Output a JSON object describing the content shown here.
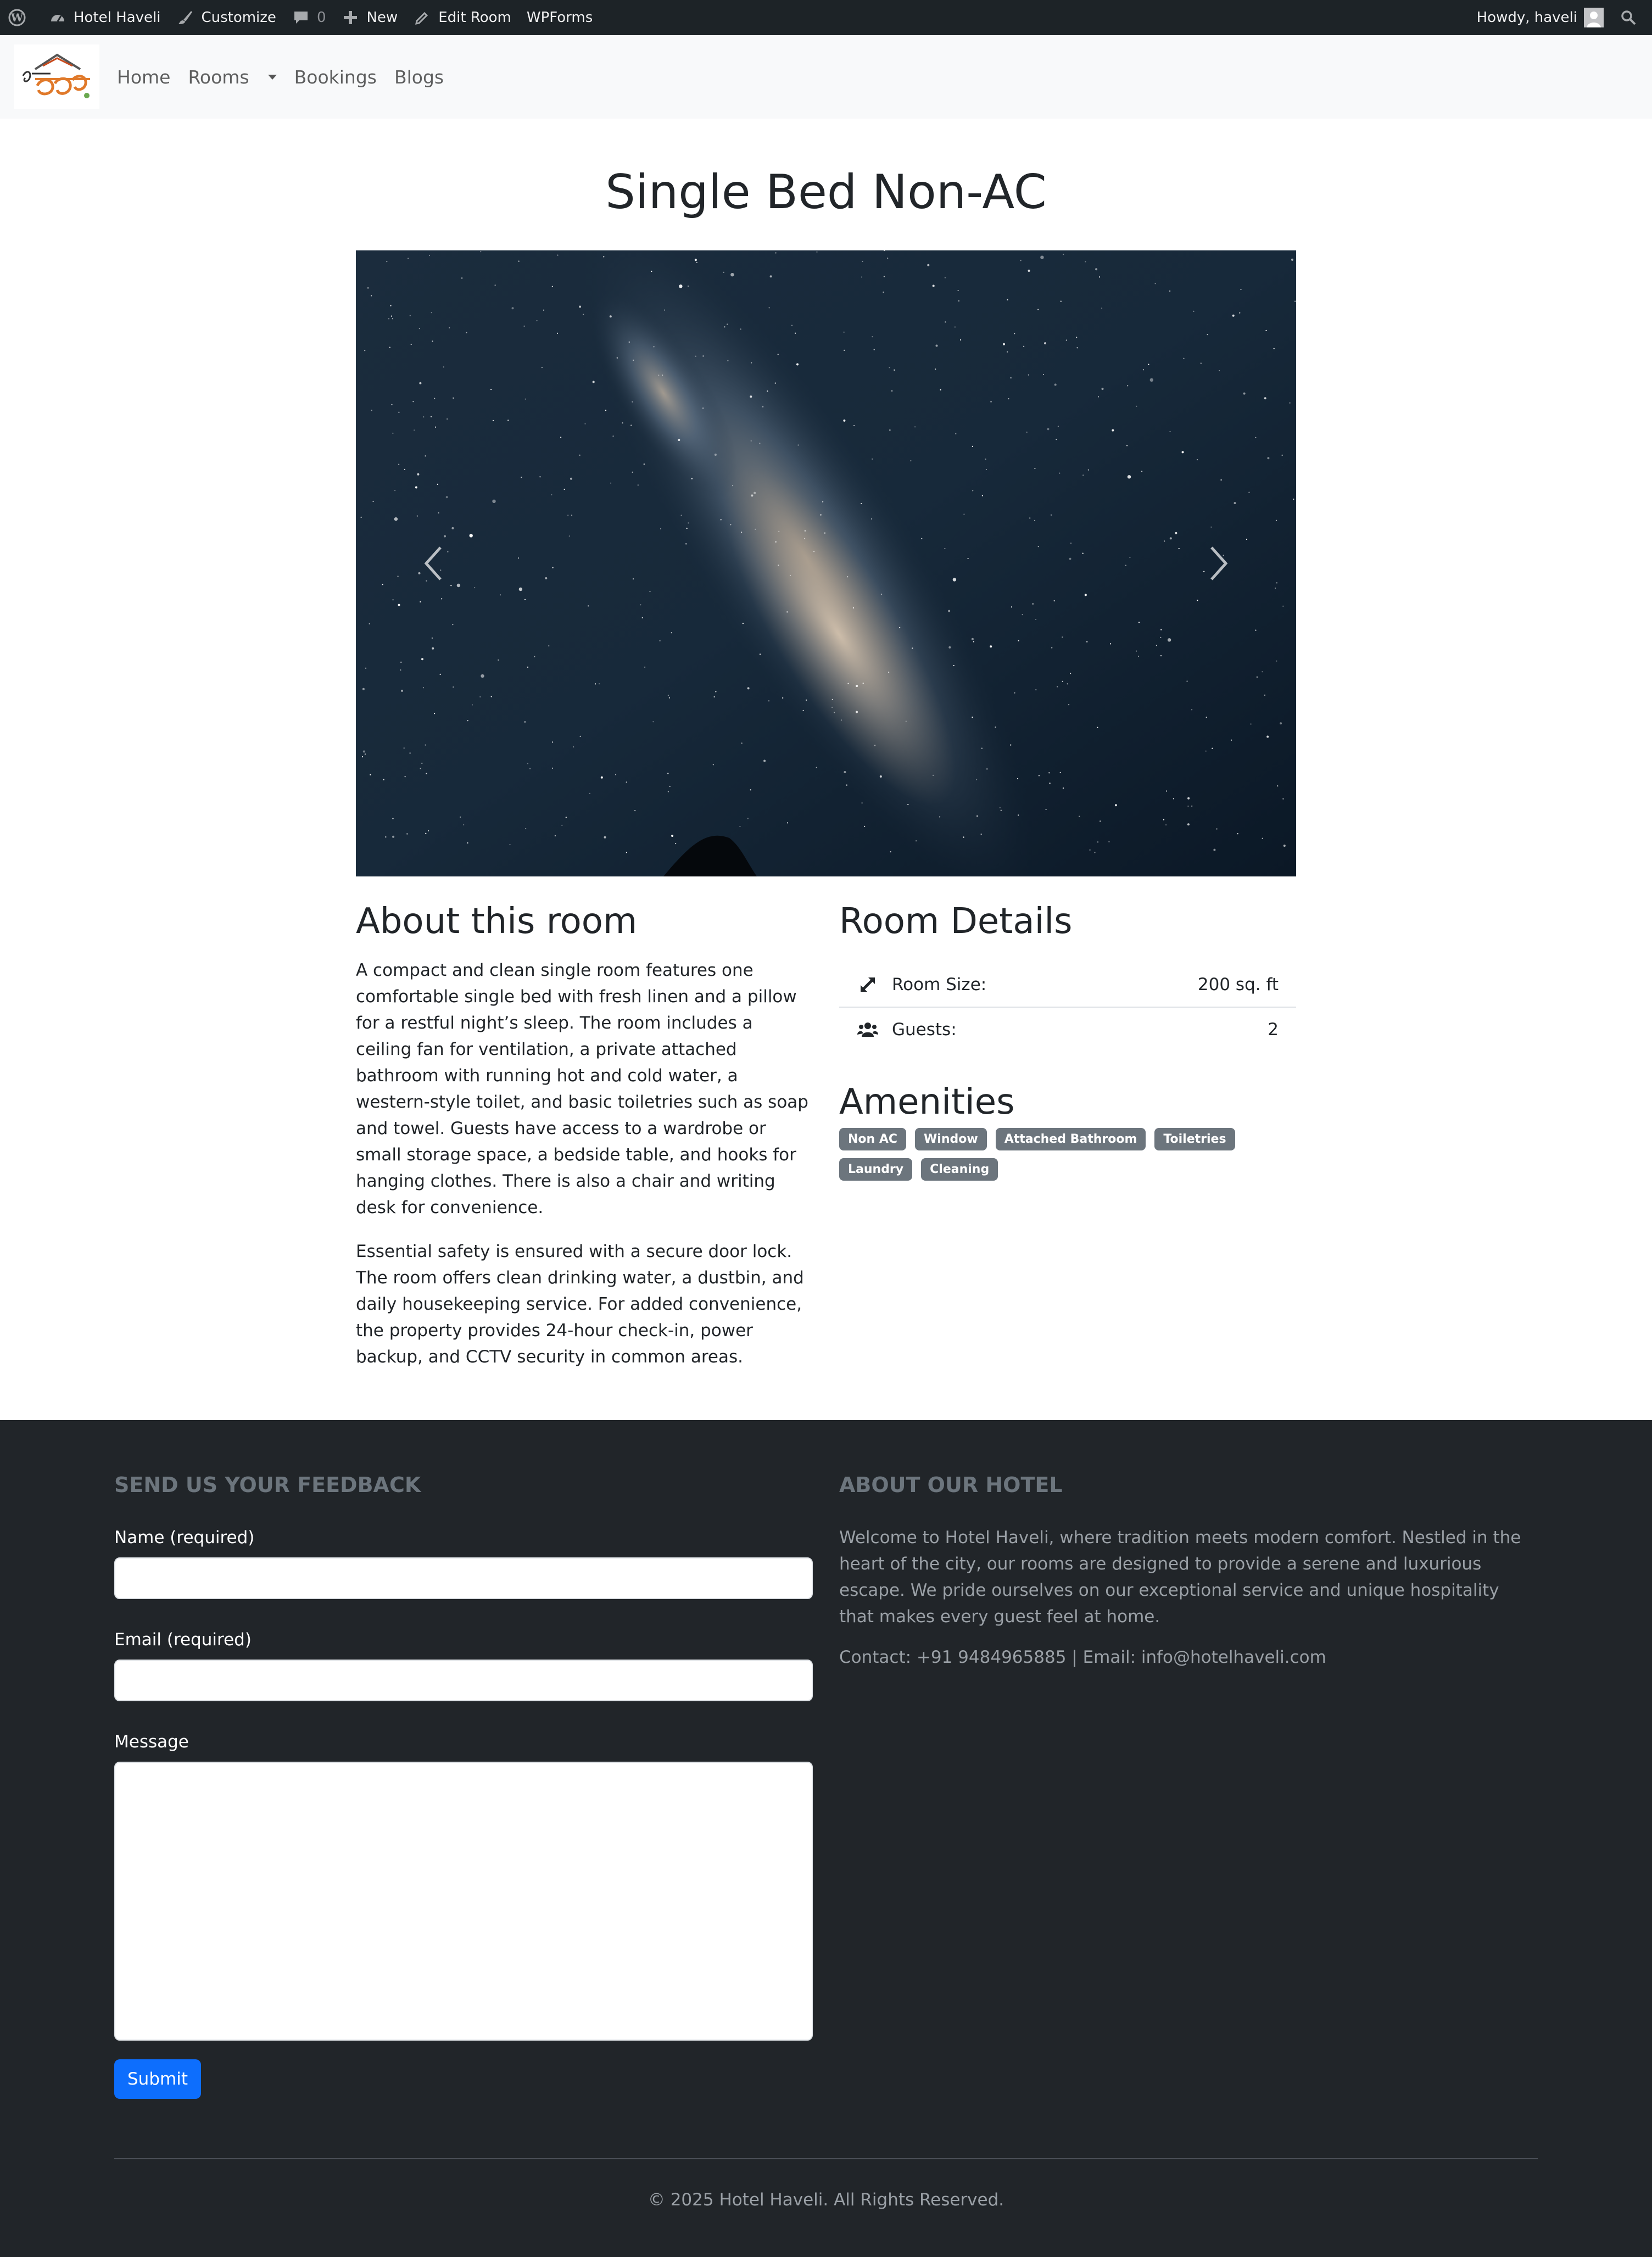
{
  "admin_bar": {
    "site_name": "Hotel Haveli",
    "customize": "Customize",
    "comments_count": "0",
    "new": "New",
    "edit_room": "Edit Room",
    "wpforms": "WPForms",
    "howdy": "Howdy, haveli"
  },
  "navbar": {
    "items": [
      {
        "label": "Home"
      },
      {
        "label": "Rooms"
      },
      {
        "label": "Bookings"
      },
      {
        "label": "Blogs"
      }
    ]
  },
  "room": {
    "title": "Single Bed Non-AC",
    "about_heading": "About this room",
    "about_paragraphs": [
      "A compact and clean single room features one comfortable single bed with fresh linen and a pillow for a restful night’s sleep. The room includes a ceiling fan for ventilation, a private attached bathroom with running hot and cold water, a western-style toilet, and basic toiletries such as soap and towel. Guests have access to a wardrobe or small storage space, a bedside table, and hooks for hanging clothes. There is also a chair and writing desk for convenience.",
      "Essential safety is ensured with a secure door lock. The room offers clean drinking water, a dustbin, and daily housekeeping service. For added convenience, the property provides 24-hour check-in, power backup, and CCTV security in common areas."
    ],
    "details_heading": "Room Details",
    "details": [
      {
        "label": "Room Size:",
        "value": "200 sq. ft",
        "icon": "expand-icon"
      },
      {
        "label": "Guests:",
        "value": "2",
        "icon": "users-icon"
      }
    ],
    "amenities_heading": "Amenities",
    "amenities": [
      "Non AC",
      "Window",
      "Attached Bathroom",
      "Toiletries",
      "Laundry",
      "Cleaning"
    ]
  },
  "footer": {
    "feedback_heading": "SEND US YOUR FEEDBACK",
    "name_label": "Name (required)",
    "email_label": "Email (required)",
    "message_label": "Message",
    "submit_label": "Submit",
    "about_heading": "ABOUT OUR HOTEL",
    "about_text": "Welcome to Hotel Haveli, where tradition meets modern comfort. Nestled in the heart of the city, our rooms are designed to provide a serene and luxurious escape. We pride ourselves on our exceptional service and unique hospitality that makes every guest feel at home.",
    "contact": "Contact: +91 9484965885 | Email: info@hotelhaveli.com",
    "copyright": "© 2025 Hotel Haveli. All Rights Reserved."
  },
  "colors": {
    "admin_bar_bg": "#1d2327",
    "navbar_bg": "#f8f9fa",
    "footer_bg": "#212529",
    "badge_bg": "#6c757d",
    "primary": "#0d6efd"
  }
}
